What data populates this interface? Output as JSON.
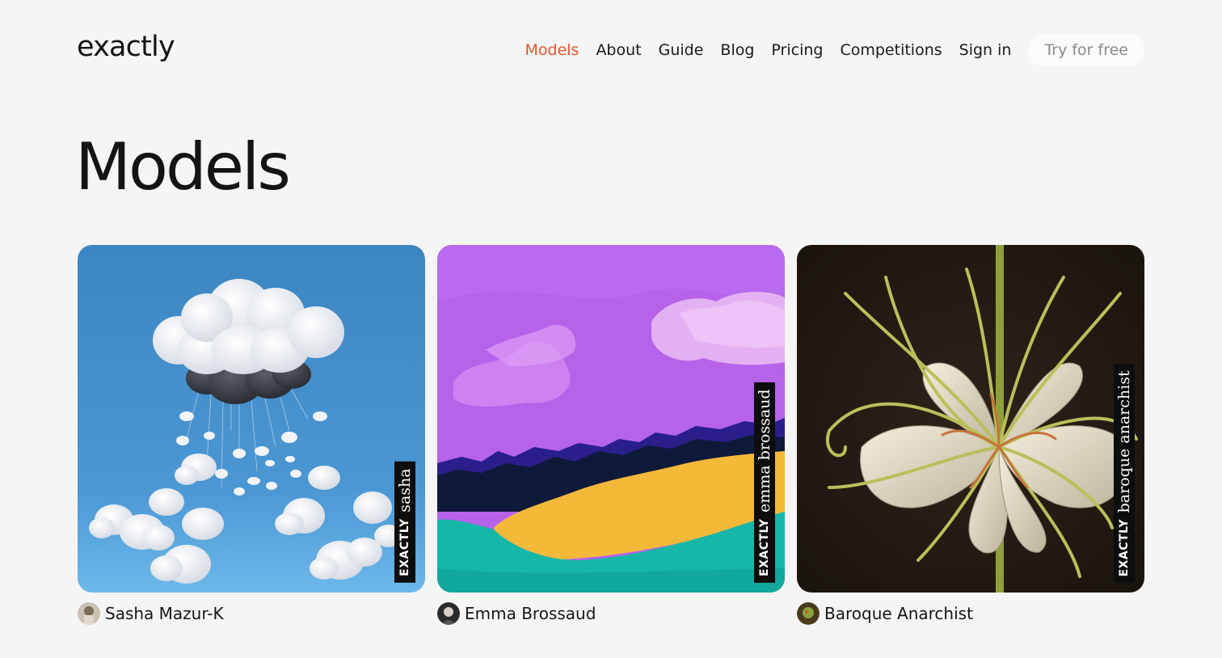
{
  "header": {
    "logo": "exactly",
    "nav": [
      "Models",
      "About",
      "Guide",
      "Blog",
      "Pricing",
      "Competitions",
      "Sign in"
    ],
    "active_nav": "Models",
    "cta": "Try for free",
    "accent_color": "#e0562a"
  },
  "page": {
    "title": "Models"
  },
  "models": [
    {
      "tag_brand": "EXACTLY",
      "tag_name": "sasha",
      "author": "Sasha Mazur-K",
      "artwork": "clouds-on-blue"
    },
    {
      "tag_brand": "EXACTLY",
      "tag_name": "emma brossaud",
      "author": "Emma Brossaud",
      "artwork": "purple-sky-landscape"
    },
    {
      "tag_brand": "EXACTLY",
      "tag_name": "baroque anarchist",
      "author": "Baroque Anarchist",
      "artwork": "white-lily-on-dark"
    }
  ]
}
